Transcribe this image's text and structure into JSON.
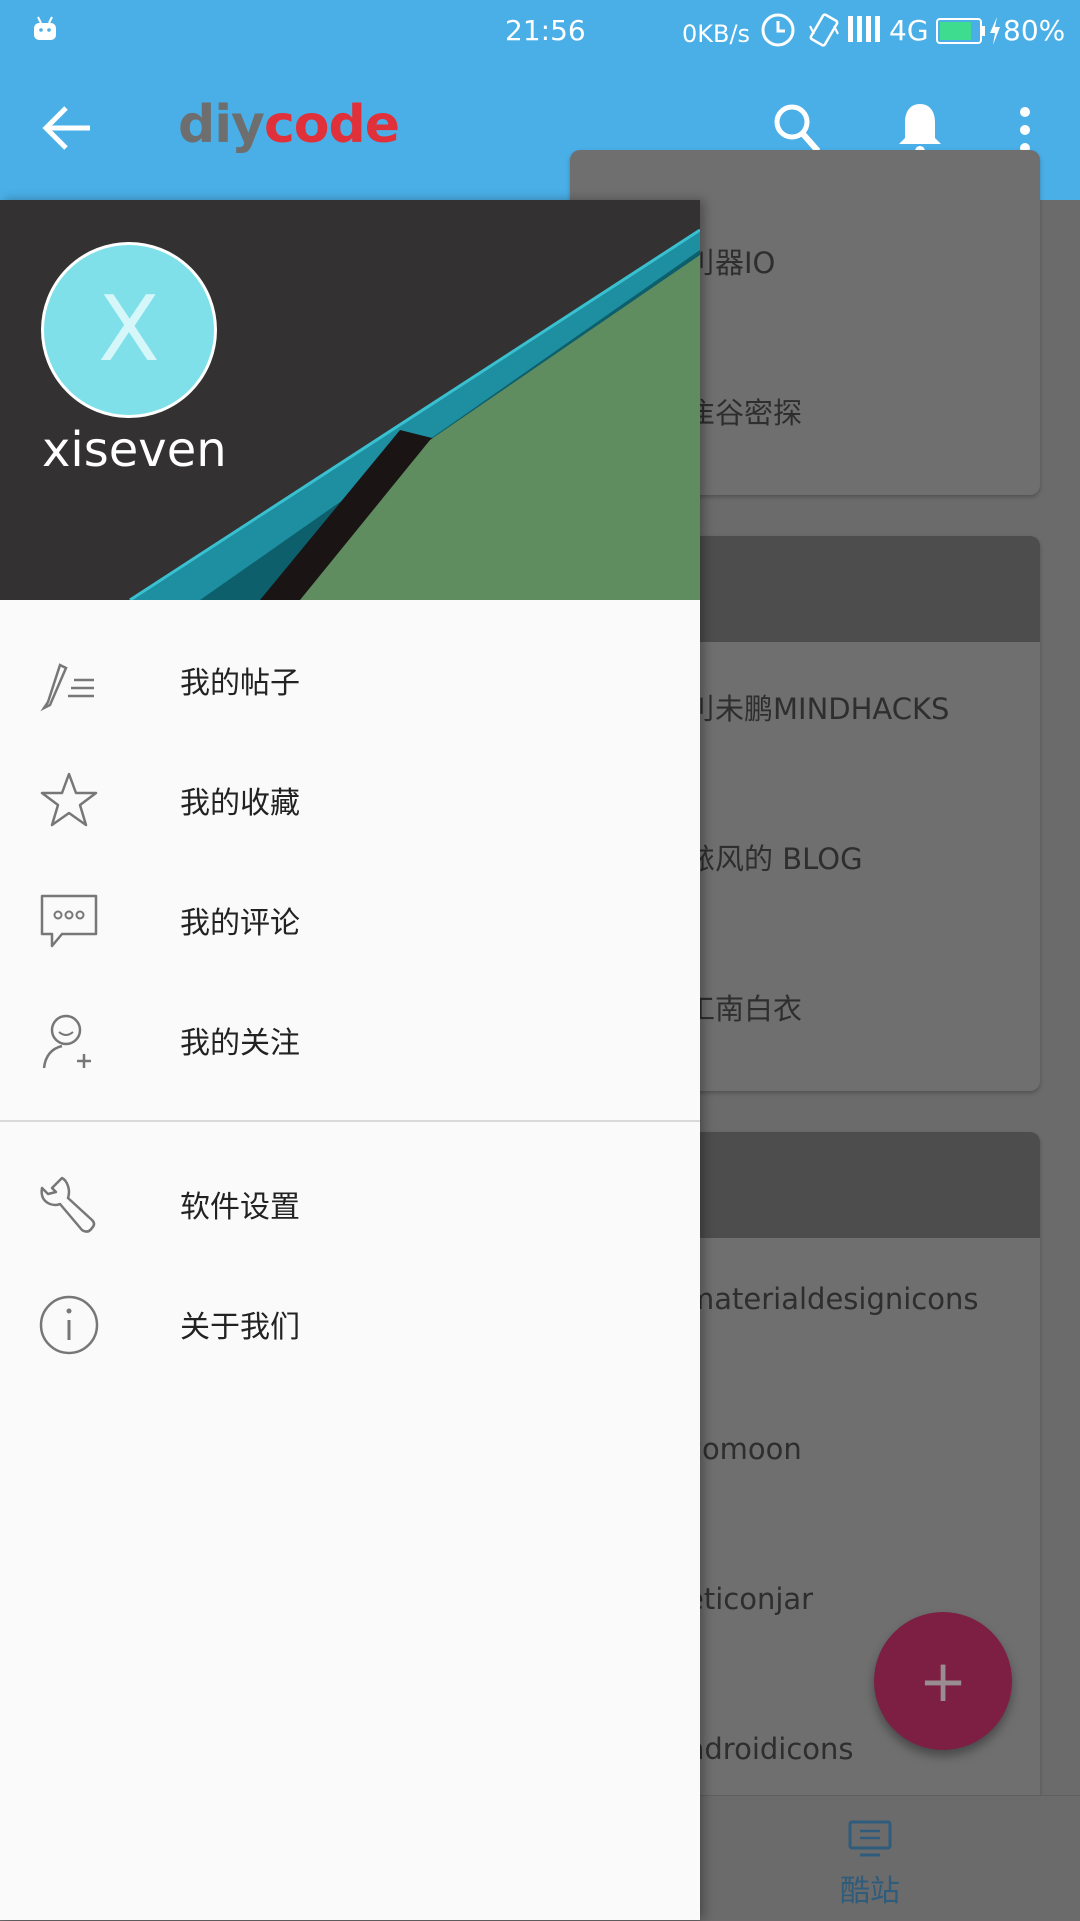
{
  "status_bar": {
    "time": "21:56",
    "network_speed": "0KB/s",
    "network_type": "4G",
    "battery_percent": "80%",
    "battery_level": 0.8
  },
  "app_bar": {
    "logo_part1": "diy",
    "logo_part2": "code",
    "colors": {
      "bar": "#4aafe7",
      "logo_gray": "#6e6e6e",
      "logo_red": "#e0303a"
    }
  },
  "drawer": {
    "avatar_letter": "X",
    "username": "xiseven",
    "items": [
      {
        "label": "我的帖子",
        "icon": "edit-list-icon"
      },
      {
        "label": "我的收藏",
        "icon": "star-icon"
      },
      {
        "label": "我的评论",
        "icon": "comment-icon"
      },
      {
        "label": "我的关注",
        "icon": "person-add-icon"
      },
      {
        "label": "软件设置",
        "icon": "wrench-icon"
      },
      {
        "label": "关于我们",
        "icon": "info-icon"
      }
    ]
  },
  "background_list": {
    "items": [
      "刂器IO",
      "隹谷密探",
      "刂未鹏MINDHACKS",
      "铱风的 BLOG",
      "工南白衣",
      "materialdesignicons",
      "comoon",
      "eticonjar",
      "ndroidicons"
    ]
  },
  "fab": {
    "symbol": "+"
  },
  "bottom_nav": {
    "label": "酷站",
    "icon": "monitor-icon"
  }
}
